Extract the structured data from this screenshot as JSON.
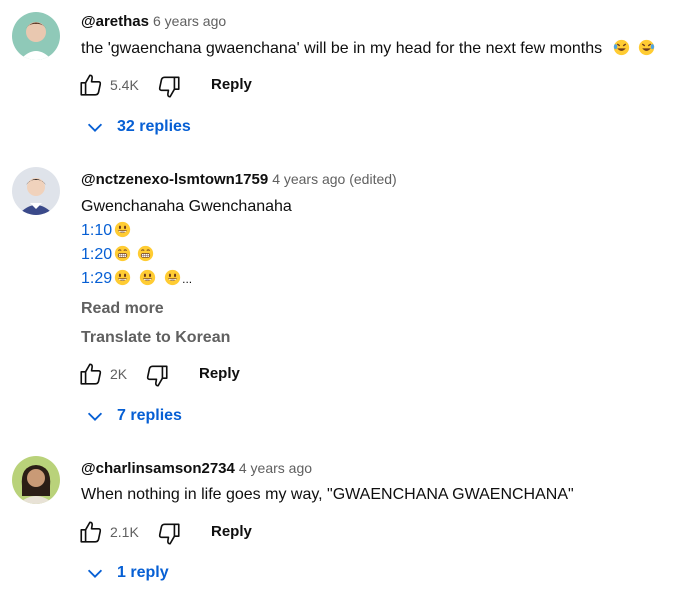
{
  "comments": [
    {
      "author": "@arethas",
      "time": "6 years ago",
      "text": "the 'gwaenchana gwaenchana' will be in my head for the next few months",
      "likes": "5.4K",
      "reply_label": "Reply",
      "replies_label": "32 replies",
      "avatar_icon": "avatar-photo"
    },
    {
      "author": "@nctzenexo-lsmtown1759",
      "time": "4 years ago (edited)",
      "line1": "Gwenchanaha Gwenchanaha",
      "ts1": "1:10",
      "ts2": "1:20",
      "ts3": "1:29",
      "ellipsis": "...",
      "read_more": "Read more",
      "translate": "Translate to Korean",
      "likes": "2K",
      "reply_label": "Reply",
      "replies_label": "7 replies",
      "avatar_icon": "avatar-photo"
    },
    {
      "author": "@charlinsamson2734",
      "time": "4 years ago",
      "text": "When nothing in life goes my way, \"GWAENCHANA GWAENCHANA\"",
      "likes": "2.1K",
      "reply_label": "Reply",
      "replies_label": "1 reply",
      "avatar_icon": "avatar-photo"
    }
  ],
  "colors": {
    "link_blue": "#065fd4",
    "meta_gray": "#606060",
    "text": "#0f0f0f",
    "emoji_yellow": "#ffcc33"
  }
}
